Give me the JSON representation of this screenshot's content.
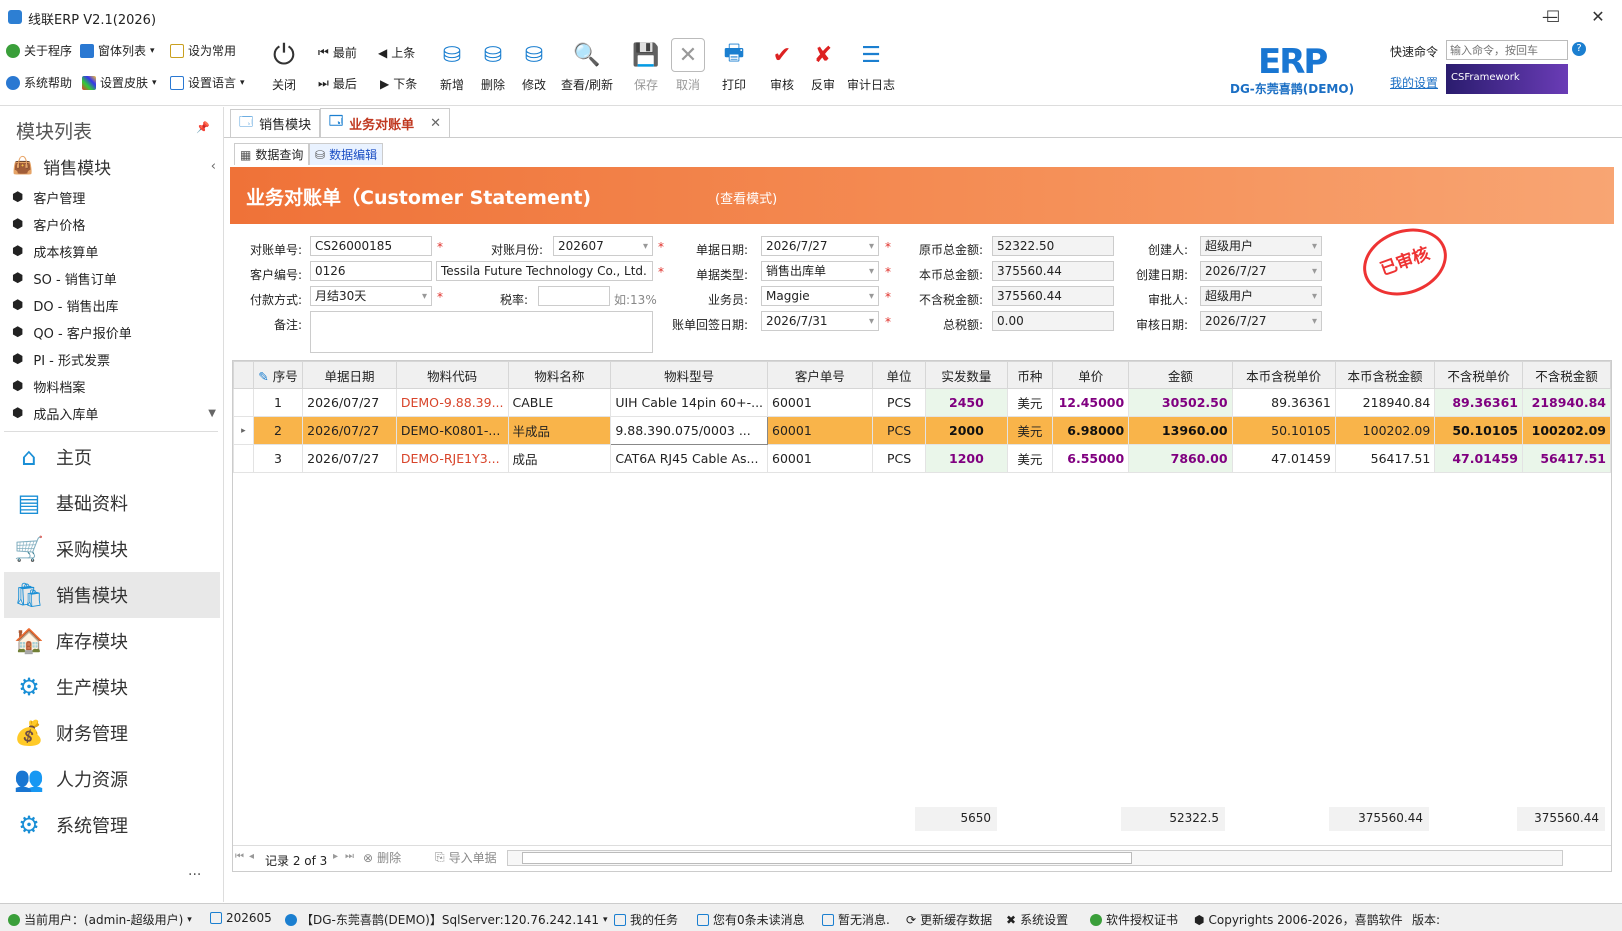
{
  "window": {
    "title": "线联ERP V2.1(2026)"
  },
  "toolbar": {
    "about": "关于程序",
    "windows": "窗体列表",
    "set_common": "设为常用",
    "help": "系统帮助",
    "skin": "设置皮肤",
    "language": "设置语言",
    "close": "关闭",
    "first": "最前",
    "prev": "上条",
    "last": "最后",
    "next": "下条",
    "add": "新增",
    "delete": "删除",
    "edit": "修改",
    "view_refresh": "查看/刷新",
    "save": "保存",
    "cancel": "取消",
    "print": "打印",
    "approve": "审核",
    "unapprove": "反审",
    "audit_log": "审计日志",
    "logo_text": "ERP",
    "company": "DG-东莞喜鹊(DEMO)",
    "quick_cmd_label": "快速命令",
    "quick_cmd_placeholder": "输入命令，按回车",
    "my_settings": "我的设置",
    "framework_badge": "CSFramework"
  },
  "sidebar": {
    "title": "模块列表",
    "group": "销售模块",
    "items": [
      "客户管理",
      "客户价格",
      "成本核算单",
      "SO - 销售订单",
      "DO - 销售出库",
      "QO - 客户报价单",
      "PI - 形式发票",
      "物料档案",
      "成品入库单"
    ],
    "modules": [
      "主页",
      "基础资料",
      "采购模块",
      "销售模块",
      "库存模块",
      "生产模块",
      "财务管理",
      "人力资源",
      "系统管理"
    ],
    "more": "···"
  },
  "tabs": {
    "t1": "销售模块",
    "t2": "业务对账单",
    "sub1": "数据查询",
    "sub2": "数据编辑"
  },
  "banner": {
    "title": "业务对账单（Customer Statement)",
    "mode": "(查看模式)"
  },
  "form": {
    "stmt_no_label": "对账单号:",
    "stmt_no": "CS26000185",
    "month_label": "对账月份:",
    "month": "202607",
    "doc_date_label": "单据日期:",
    "doc_date": "2026/7/27",
    "orig_total_label": "原币总金额:",
    "orig_total": "52322.50",
    "creator_label": "创建人:",
    "creator": "超级用户",
    "cust_label": "客户编号:",
    "cust_code": "0126",
    "cust_name": "Tessila Future Technology Co., Ltd.",
    "doc_type_label": "单据类型:",
    "doc_type": "销售出库单",
    "local_total_label": "本币总金额:",
    "local_total": "375560.44",
    "create_date_label": "创建日期:",
    "create_date": "2026/7/27",
    "pay_label": "付款方式:",
    "pay": "月结30天",
    "tax_label": "税率:",
    "tax_value": "",
    "tax_hint": "如:13%",
    "sales_label": "业务员:",
    "sales": "Maggie",
    "excl_label": "不含税金额:",
    "excl": "375560.44",
    "approver_label": "审批人:",
    "approver": "超级用户",
    "remark_label": "备注:",
    "remark": "",
    "return_date_label": "账单回签日期:",
    "return_date": "2026/7/31",
    "tax_total_label": "总税额:",
    "tax_total": "0.00",
    "approve_date_label": "审核日期:",
    "approve_date": "2026/7/27",
    "stamp": "已审核"
  },
  "grid": {
    "headers": [
      "序号",
      "单据日期",
      "物料代码",
      "物料名称",
      "物料型号",
      "客户单号",
      "单位",
      "实发数量",
      "币种",
      "单价",
      "金额",
      "本币含税单价",
      "本币含税金额",
      "不含税单价",
      "不含税金额"
    ],
    "rows": [
      [
        "1",
        "2026/07/27",
        "DEMO-9.88.39...",
        "CABLE",
        "UIH Cable 14pin 60+-...",
        "60001",
        "PCS",
        "2450",
        "美元",
        "12.45000",
        "30502.50",
        "89.36361",
        "218940.84",
        "89.36361",
        "218940.84"
      ],
      [
        "2",
        "2026/07/27",
        "DEMO-K0801-...",
        "半成品",
        "9.88.390.075/0003 ...",
        "60001",
        "PCS",
        "2000",
        "美元",
        "6.98000",
        "13960.00",
        "50.10105",
        "100202.09",
        "50.10105",
        "100202.09"
      ],
      [
        "3",
        "2026/07/27",
        "DEMO-RJE1Y3...",
        "成品",
        "CAT6A RJ45 Cable As...",
        "60001",
        "PCS",
        "1200",
        "美元",
        "6.55000",
        "7860.00",
        "47.01459",
        "56417.51",
        "47.01459",
        "56417.51"
      ]
    ],
    "totals": {
      "qty": "5650",
      "amount": "52322.5",
      "local_amount": "375560.44",
      "excl_amount": "375560.44"
    },
    "nav": {
      "record": "记录 2 of 3",
      "delete": "删除",
      "import": "导入单据"
    }
  },
  "status": {
    "user": "当前用户：(admin-超级用户)",
    "period": "202605",
    "server": "【DG-东莞喜鹊(DEMO)】SqlServer:120.76.242.141",
    "tasks": "我的任务",
    "unread": "您有0条未读消息",
    "notice": "暂无消息.",
    "refresh_cache": "更新缓存数据",
    "settings": "系统设置",
    "license": "软件授权证书",
    "copyright": "Copyrights 2006-2026，喜鹊软件",
    "version": "版本:"
  }
}
